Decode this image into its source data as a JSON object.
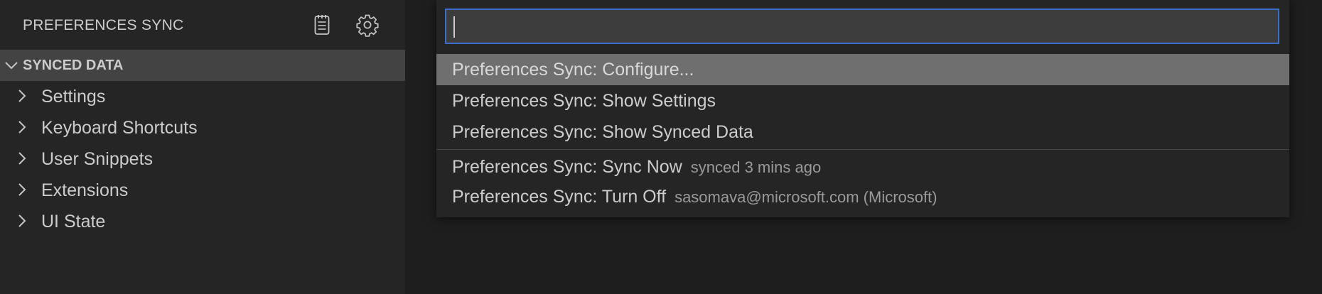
{
  "sidebar": {
    "title": "PREFERENCES SYNC",
    "actions": [
      {
        "icon": "notes-icon",
        "label": "Show Log"
      },
      {
        "icon": "gear-icon",
        "label": "Manage"
      }
    ],
    "section": {
      "label": "SYNCED DATA",
      "icon": "chevron-down-icon"
    },
    "items": [
      {
        "label": "Settings",
        "icon": "chevron-right-icon"
      },
      {
        "label": "Keyboard Shortcuts",
        "icon": "chevron-right-icon"
      },
      {
        "label": "User Snippets",
        "icon": "chevron-right-icon"
      },
      {
        "label": "Extensions",
        "icon": "chevron-right-icon"
      },
      {
        "label": "UI State",
        "icon": "chevron-right-icon"
      }
    ]
  },
  "quick_pick": {
    "input_value": "",
    "items": [
      {
        "label": "Preferences Sync: Configure...",
        "description": "",
        "selected": true
      },
      {
        "label": "Preferences Sync: Show Settings",
        "description": ""
      },
      {
        "label": "Preferences Sync: Show Synced Data",
        "description": ""
      },
      {
        "label": "Preferences Sync: Sync Now",
        "description": "synced 3 mins ago"
      },
      {
        "label": "Preferences Sync: Turn Off",
        "description": "sasomava@microsoft.com (Microsoft)"
      }
    ]
  },
  "colors": {
    "sidebar_bg": "#252526",
    "section_header_bg": "#434343",
    "editor_bg": "#1e1e1e",
    "selection_bg": "#6f6f6f",
    "focus_border": "#3b6fc8",
    "foreground": "#cccccc",
    "description": "#9a9a9a"
  }
}
